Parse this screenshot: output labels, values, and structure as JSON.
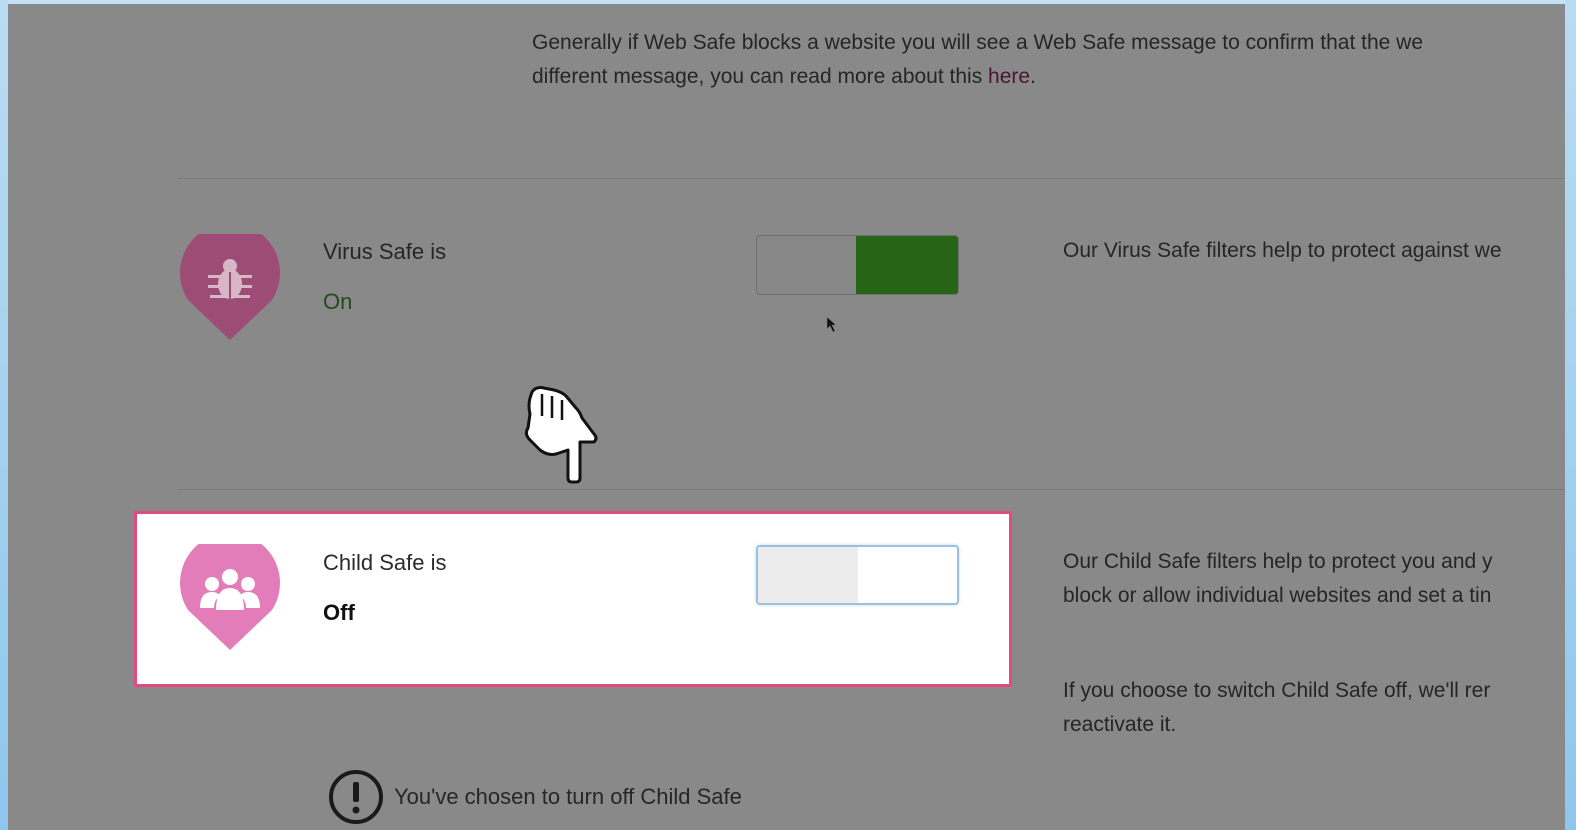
{
  "intro": {
    "line1": "Generally if Web Safe blocks a website you will see a Web Safe message to confirm that the we",
    "line2_prefix": "different message, you can read more about this ",
    "link": "here",
    "line2_suffix": "."
  },
  "virus_safe": {
    "label": "Virus Safe is",
    "status": "On",
    "description": "Our Virus Safe filters help to protect against we",
    "icon": "bug-icon",
    "toggle_state": "on"
  },
  "child_safe": {
    "label": "Child Safe is",
    "status": "Off",
    "description_line1": "Our Child Safe filters help to protect you and y",
    "description_line2": "block or allow individual websites and set a tin",
    "description2_line1": "If you choose to switch Child Safe off, we'll rer",
    "description2_line2": "reactivate it.",
    "icon": "family-icon",
    "toggle_state": "off"
  },
  "warning": {
    "icon": "exclamation-circle-icon",
    "text": "You've chosen to turn off Child Safe"
  },
  "colors": {
    "overlay": "#898989",
    "highlight_border": "#e24b7b",
    "toggle_on": "#276516",
    "badge_pink": "#e46fae"
  }
}
